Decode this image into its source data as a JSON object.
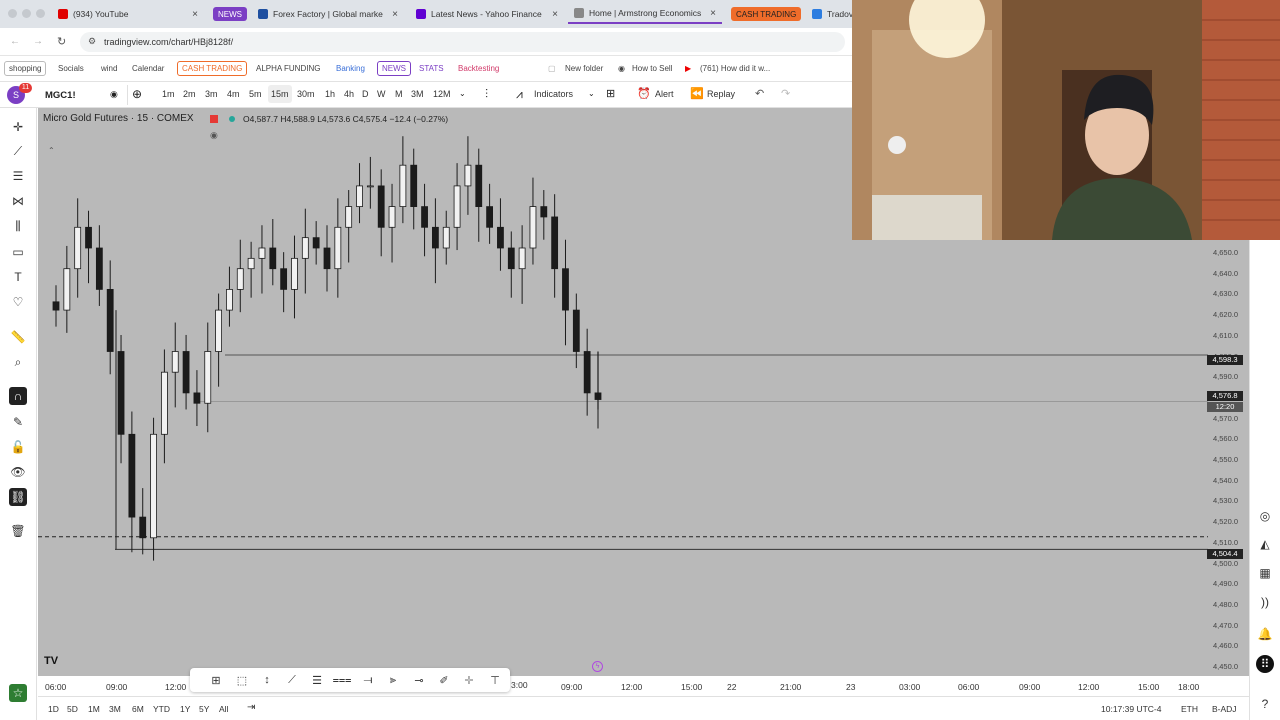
{
  "browser": {
    "tabs": [
      {
        "label": "(934) YouTube",
        "color": "#e00000"
      },
      {
        "label": "NEWS",
        "kind": "news"
      },
      {
        "label": "Forex Factory | Global market",
        "color": "#1e4fa0"
      },
      {
        "label": "Latest News - Yahoo Finance",
        "color": "#6001d2"
      },
      {
        "label": "Home | Armstrong Economics",
        "color": "#555555"
      },
      {
        "label": "CASH TRADING",
        "kind": "cash"
      },
      {
        "label": "Tradov",
        "color": "#2d7de0"
      }
    ],
    "url": "tradingview.com/chart/HBj8128f/",
    "bookmarks": [
      "shopping",
      "Socials",
      "wind",
      "Calendar",
      "CASH TRADING",
      "ALPHA FUNDING",
      "Banking",
      "NEWS",
      "STATS",
      "Backtesting",
      "New folder",
      "How to Sell",
      "(761) How did it w..."
    ]
  },
  "toolbar": {
    "notif_count": "11",
    "symbol": "MGC1!",
    "timeframes": [
      "1m",
      "2m",
      "3m",
      "4m",
      "5m",
      "15m",
      "30m",
      "1h",
      "4h",
      "D",
      "W",
      "M",
      "3M",
      "12M"
    ],
    "active_timeframe": "15m",
    "indicators_label": "Indicators",
    "alert_label": "Alert",
    "replay_label": "Replay"
  },
  "chart_header": {
    "title": "Micro Gold Futures · 15 · COMEX",
    "ohlc": "O4,587.7  H4,588.9  L4,573.6  C4,575.4  −12.4 (−0.27%)"
  },
  "price_axis": [
    "4,650.0",
    "4,640.0",
    "4,630.0",
    "4,620.0",
    "4,610.0",
    "4,600.0",
    "4,590.0",
    "4,580.0",
    "4,570.0",
    "4,560.0",
    "4,550.0",
    "4,540.0",
    "4,530.0",
    "4,520.0",
    "4,510.0",
    "4,500.0",
    "4,490.0",
    "4,480.0",
    "4,470.0",
    "4,460.0",
    "4,450.0"
  ],
  "price_tags": {
    "level_high": "4,598.3",
    "last_price": "4,576.8",
    "countdown": "12:20",
    "level_low": "4,504.4"
  },
  "time_axis": [
    "06:00",
    "09:00",
    "12:00",
    "09:00",
    "12:00",
    "15:00",
    "22",
    "21:00",
    "23",
    "03:00",
    "06:00",
    "09:00",
    "12:00",
    "15:00",
    "18:00"
  ],
  "time_axis_partial": "3:00",
  "ranges": [
    "1D",
    "5D",
    "1M",
    "3M",
    "6M",
    "YTD",
    "1Y",
    "5Y",
    "All"
  ],
  "status": {
    "clock": "10:17:39 UTC-4",
    "session": "ETH",
    "adj": "B-ADJ"
  },
  "logo_text": "TV",
  "chart_data": {
    "type": "candlestick",
    "title": "Micro Gold Futures · 15 · COMEX",
    "ylim": [
      4445,
      4655
    ],
    "horizontal_levels": [
      4598.3,
      4576.8,
      4504.4
    ],
    "dashed_level": 4510.0,
    "approx_close_series": [
      4620,
      4640,
      4660,
      4650,
      4630,
      4600,
      4560,
      4520,
      4510,
      4560,
      4590,
      4600,
      4580,
      4575,
      4600,
      4620,
      4630,
      4640,
      4645,
      4650,
      4640,
      4630,
      4645,
      4655,
      4650,
      4640,
      4660,
      4670,
      4680,
      4680,
      4660,
      4670,
      4690,
      4670,
      4660,
      4650,
      4660,
      4680,
      4690,
      4670,
      4660,
      4650,
      4640,
      4650,
      4670,
      4665,
      4640,
      4620,
      4600,
      4580,
      4576.8
    ]
  }
}
